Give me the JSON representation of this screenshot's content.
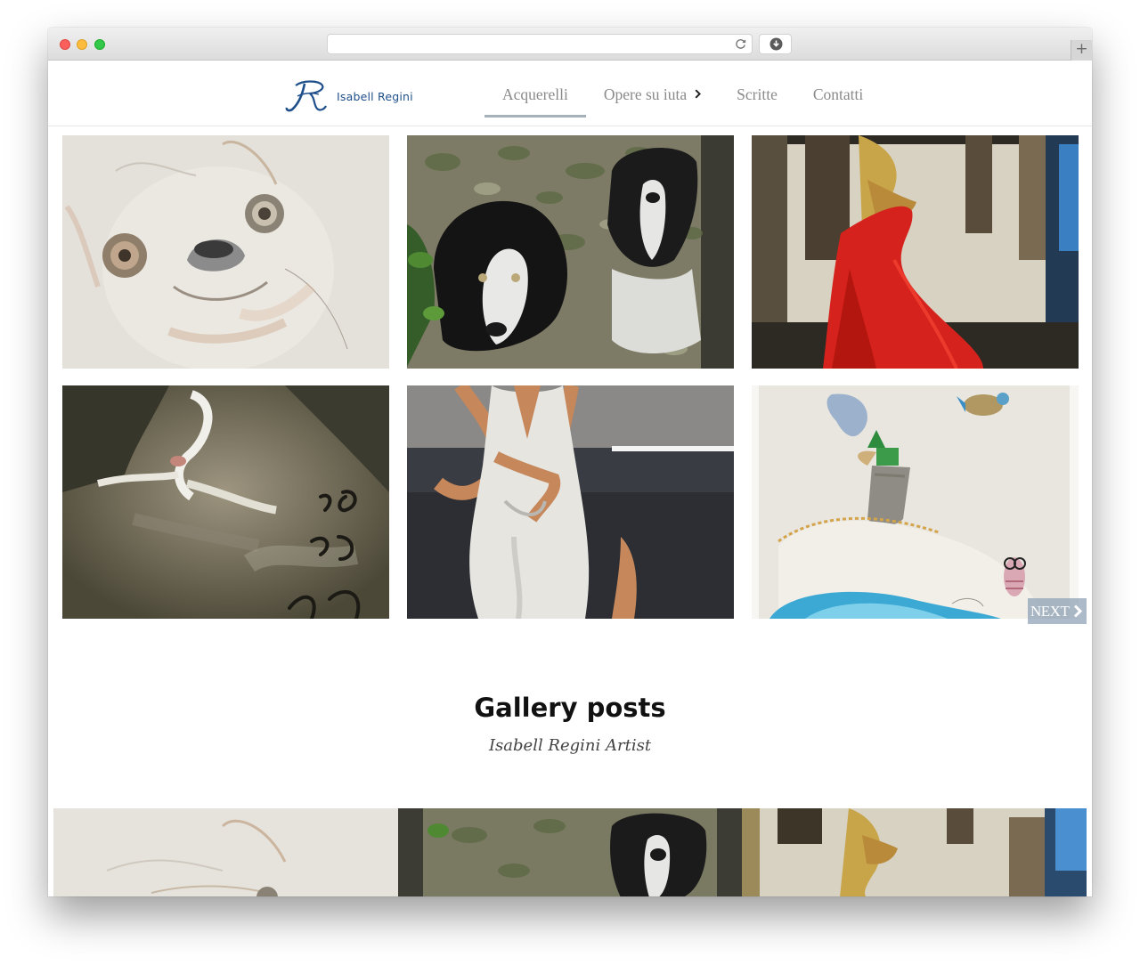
{
  "browser": {
    "url": "",
    "new_tab_label": "+"
  },
  "site": {
    "logo_text": "Isabell Regini",
    "nav": [
      {
        "label": "Acquerelli",
        "active": true
      },
      {
        "label": "Opere su iuta",
        "has_submenu": true
      },
      {
        "label": "Scritte"
      },
      {
        "label": "Contatti"
      }
    ]
  },
  "gallery": {
    "items": [
      {
        "subject": "watercolor-french-bulldog"
      },
      {
        "subject": "border-collie-puppies-on-burlap"
      },
      {
        "subject": "woman-in-red-dress"
      },
      {
        "subject": "cat-with-calligraphy"
      },
      {
        "subject": "woman-in-white-dress"
      },
      {
        "subject": "boat-with-bird-and-owl"
      }
    ],
    "next_label": "NEXT"
  },
  "section": {
    "title": "Gallery posts",
    "subtitle": "Isabell Regini Artist"
  },
  "colors": {
    "logo_blue": "#1f4f8b",
    "nav_text": "#8a8a8a",
    "active_underline": "#a6b0bb",
    "next_bg": "#8ca0b4"
  }
}
